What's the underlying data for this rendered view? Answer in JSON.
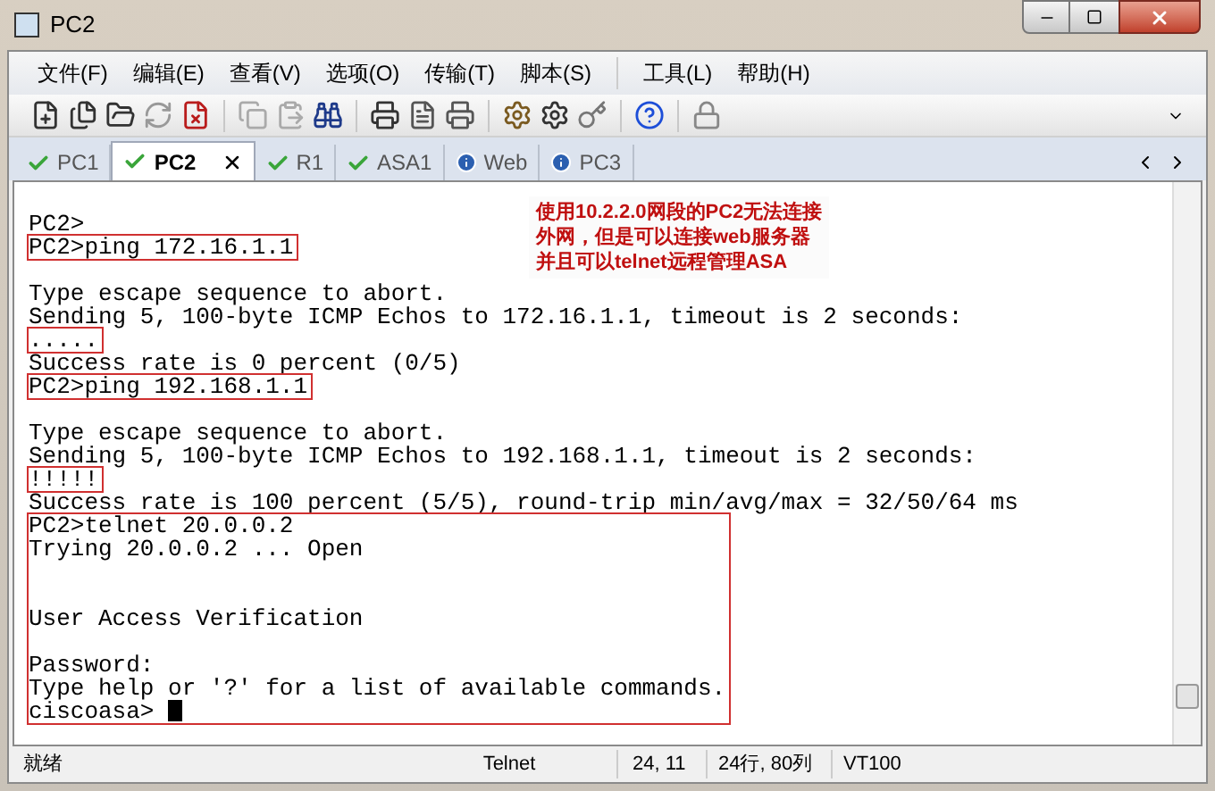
{
  "window": {
    "title": "PC2"
  },
  "menu": [
    "文件(F)",
    "编辑(E)",
    "查看(V)",
    "选项(O)",
    "传输(T)",
    "脚本(S)",
    "工具(L)",
    "帮助(H)"
  ],
  "tabs": [
    {
      "label": "PC1",
      "kind": "connected",
      "selected": false
    },
    {
      "label": "PC2",
      "kind": "connected",
      "selected": true
    },
    {
      "label": "R1",
      "kind": "connected",
      "selected": false
    },
    {
      "label": "ASA1",
      "kind": "connected",
      "selected": false
    },
    {
      "label": "Web",
      "kind": "info",
      "selected": false
    },
    {
      "label": "PC3",
      "kind": "info",
      "selected": false
    }
  ],
  "terminal": {
    "blocks": [
      {
        "boxed": false,
        "lines": [
          {
            "text": "PC2>",
            "gap_before": true
          }
        ]
      },
      {
        "boxed": true,
        "lines": [
          {
            "text": "PC2>ping 172.16.1.1"
          }
        ]
      },
      {
        "boxed": false,
        "lines": [
          {
            "text": "Type escape sequence to abort.",
            "gap_before": true
          },
          {
            "text": "Sending 5, 100-byte ICMP Echos to 172.16.1.1, timeout is 2 seconds:"
          }
        ]
      },
      {
        "boxed": true,
        "lines": [
          {
            "text": "....."
          }
        ]
      },
      {
        "boxed": false,
        "lines": [
          {
            "text": "Success rate is 0 percent (0/5)"
          }
        ]
      },
      {
        "boxed": true,
        "lines": [
          {
            "text": "PC2>ping 192.168.1.1"
          }
        ]
      },
      {
        "boxed": false,
        "lines": [
          {
            "text": "Type escape sequence to abort.",
            "gap_before": true
          },
          {
            "text": "Sending 5, 100-byte ICMP Echos to 192.168.1.1, timeout is 2 seconds:"
          }
        ]
      },
      {
        "boxed": true,
        "lines": [
          {
            "text": "!!!!!"
          }
        ]
      },
      {
        "boxed": false,
        "lines": [
          {
            "text": "Success rate is 100 percent (5/5), round-trip min/avg/max = 32/50/64 ms"
          }
        ]
      },
      {
        "boxed": true,
        "lines": [
          {
            "text": "PC2>telnet 20.0.0.2"
          },
          {
            "text": "Trying 20.0.0.2 ... Open"
          },
          {
            "text": "User Access Verification",
            "gap_before": true,
            "wide_gap": true
          },
          {
            "text": "Password:",
            "gap_before": true
          },
          {
            "text": "Type help or '?' for a list of available commands."
          },
          {
            "text": "ciscoasa>"
          }
        ]
      }
    ],
    "annotation": [
      "使用10.2.2.0网段的PC2无法连接",
      "外网，但是可以连接web服务器",
      "并且可以telnet远程管理ASA"
    ]
  },
  "status_bar": [
    "就绪",
    "Telnet",
    "24, 11",
    "24行, 80列",
    "VT100"
  ]
}
